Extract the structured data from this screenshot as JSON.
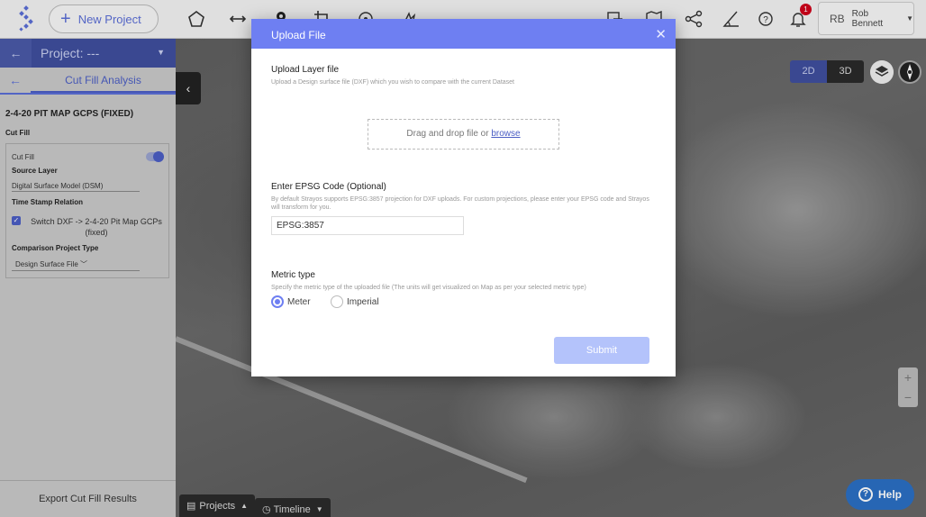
{
  "topbar": {
    "new_project_label": "New Project",
    "notification_count": "1",
    "user_initials": "RB",
    "user_name": "Rob Bennett"
  },
  "sidebar": {
    "project_title": "Project: ---",
    "tab_title": "Cut Fill Analysis",
    "map_name": "2-4-20 PIT MAP GCPS (FIXED)",
    "section_label": "Cut Fill",
    "cut_fill_toggle_label": "Cut Fill",
    "source_layer_label": "Source Layer",
    "source_layer_value": "Digital Surface Model (DSM)",
    "time_stamp_label": "Time Stamp Relation",
    "switch_text": "Switch DXF -> 2-4-20 Pit Map GCPs (fixed)",
    "comparison_label": "Comparison Project Type",
    "comparison_value": "Design Surface File",
    "export_label": "Export Cut Fill Results"
  },
  "map": {
    "view_2d": "2D",
    "view_3d": "3D",
    "zoom_in": "+",
    "zoom_out": "−",
    "projects_label": "Projects",
    "timeline_label": "Timeline",
    "help_label": "Help"
  },
  "modal": {
    "title": "Upload File",
    "upload_title": "Upload Layer file",
    "upload_desc": "Upload a Design surface file (DXF) which you wish to compare with the current Dataset",
    "dropzone_text": "Drag and drop file or ",
    "dropzone_link": "browse",
    "epsg_title": "Enter EPSG Code (Optional)",
    "epsg_desc": "By default Strayos supports EPSG:3857 projection for DXF uploads. For custom projections, please enter your EPSG code and Strayos will transform for you.",
    "epsg_value": "EPSG:3857",
    "metric_title": "Metric type",
    "metric_desc": "Specify the metric type of the uploaded file (The units will get visualized on Map as per your selected metric type)",
    "metric_options": [
      "Meter",
      "Imperial"
    ],
    "selected_metric": "Meter",
    "submit_label": "Submit"
  },
  "colors": {
    "accent": "#6e7ff2",
    "sidebar_header": "#3f4f9e",
    "submit_disabled": "#b4c3fb",
    "help": "#2b6fc4"
  }
}
